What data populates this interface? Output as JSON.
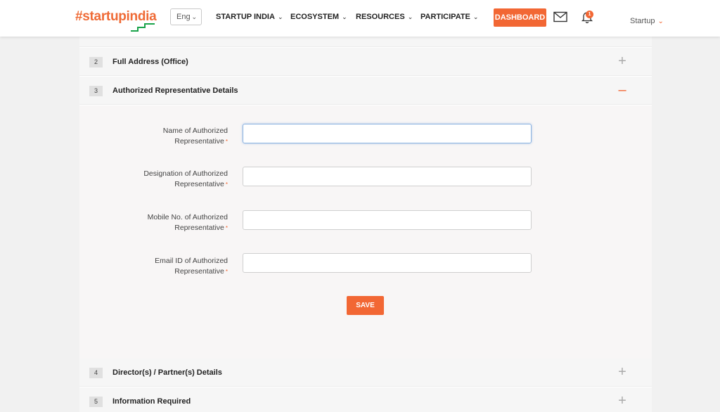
{
  "header": {
    "logo_text": "#startupindia",
    "language": "Eng",
    "nav": [
      {
        "label": "STARTUP INDIA"
      },
      {
        "label": "ECOSYSTEM"
      },
      {
        "label": "RESOURCES"
      },
      {
        "label": "PARTICIPATE"
      }
    ],
    "dashboard_label": "DASHBOARD",
    "notification_count": "1",
    "user_label": "Startup",
    "accent_color": "#f26734"
  },
  "accordion": {
    "sections": [
      {
        "number": "2",
        "title": "Full Address (Office)",
        "state": "collapsed"
      },
      {
        "number": "3",
        "title": "Authorized Representative Details",
        "state": "expanded"
      },
      {
        "number": "4",
        "title": "Director(s) / Partner(s) Details",
        "state": "collapsed"
      },
      {
        "number": "5",
        "title": "Information Required",
        "state": "collapsed"
      }
    ],
    "form": {
      "fields": [
        {
          "label_line1": "Name of Authorized",
          "label_line2": "Representative",
          "value": "",
          "required": "*"
        },
        {
          "label_line1": "Designation of Authorized",
          "label_line2": "Representative",
          "value": "",
          "required": "*"
        },
        {
          "label_line1": "Mobile No. of Authorized",
          "label_line2": "Representative",
          "value": "",
          "required": "*"
        },
        {
          "label_line1": "Email ID of Authorized",
          "label_line2": "Representative",
          "value": "",
          "required": "*"
        }
      ],
      "save_label": "SAVE"
    }
  }
}
